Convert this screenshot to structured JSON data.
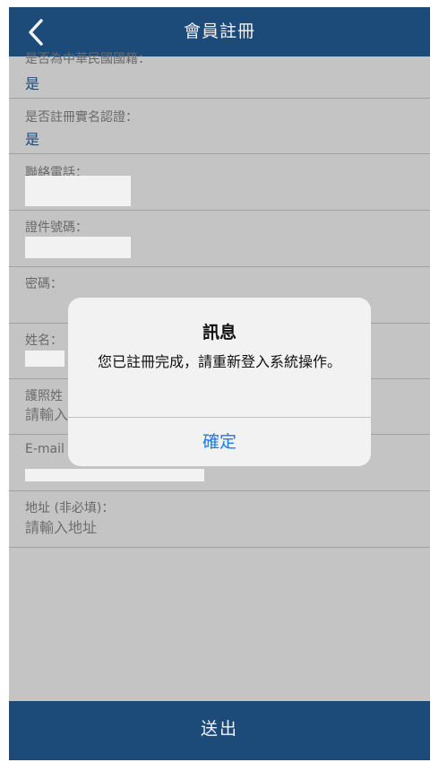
{
  "header": {
    "title": "會員註冊"
  },
  "form": {
    "nationality": {
      "label": "是否為中華民國國籍：",
      "value": "是"
    },
    "real_name_verified": {
      "label": "是否註冊實名認證：",
      "value": "是"
    },
    "phone": {
      "label": "聯絡電話："
    },
    "id_number": {
      "label": "證件號碼："
    },
    "password": {
      "label": "密碼："
    },
    "name": {
      "label": "姓名："
    },
    "passport_name": {
      "label": "護照姓",
      "placeholder": "請輸入"
    },
    "email": {
      "label": "E-mail"
    },
    "address": {
      "label": "地址 (非必填)：",
      "placeholder": "請輸入地址"
    }
  },
  "footer": {
    "submit_label": "送出"
  },
  "dialog": {
    "title": "訊息",
    "message": "您已註冊完成，請重新登入系統操作。",
    "confirm_label": "確定"
  },
  "colors": {
    "brand": "#1e4f80",
    "background": "#cfcfcf",
    "link": "#1a7bf0"
  }
}
